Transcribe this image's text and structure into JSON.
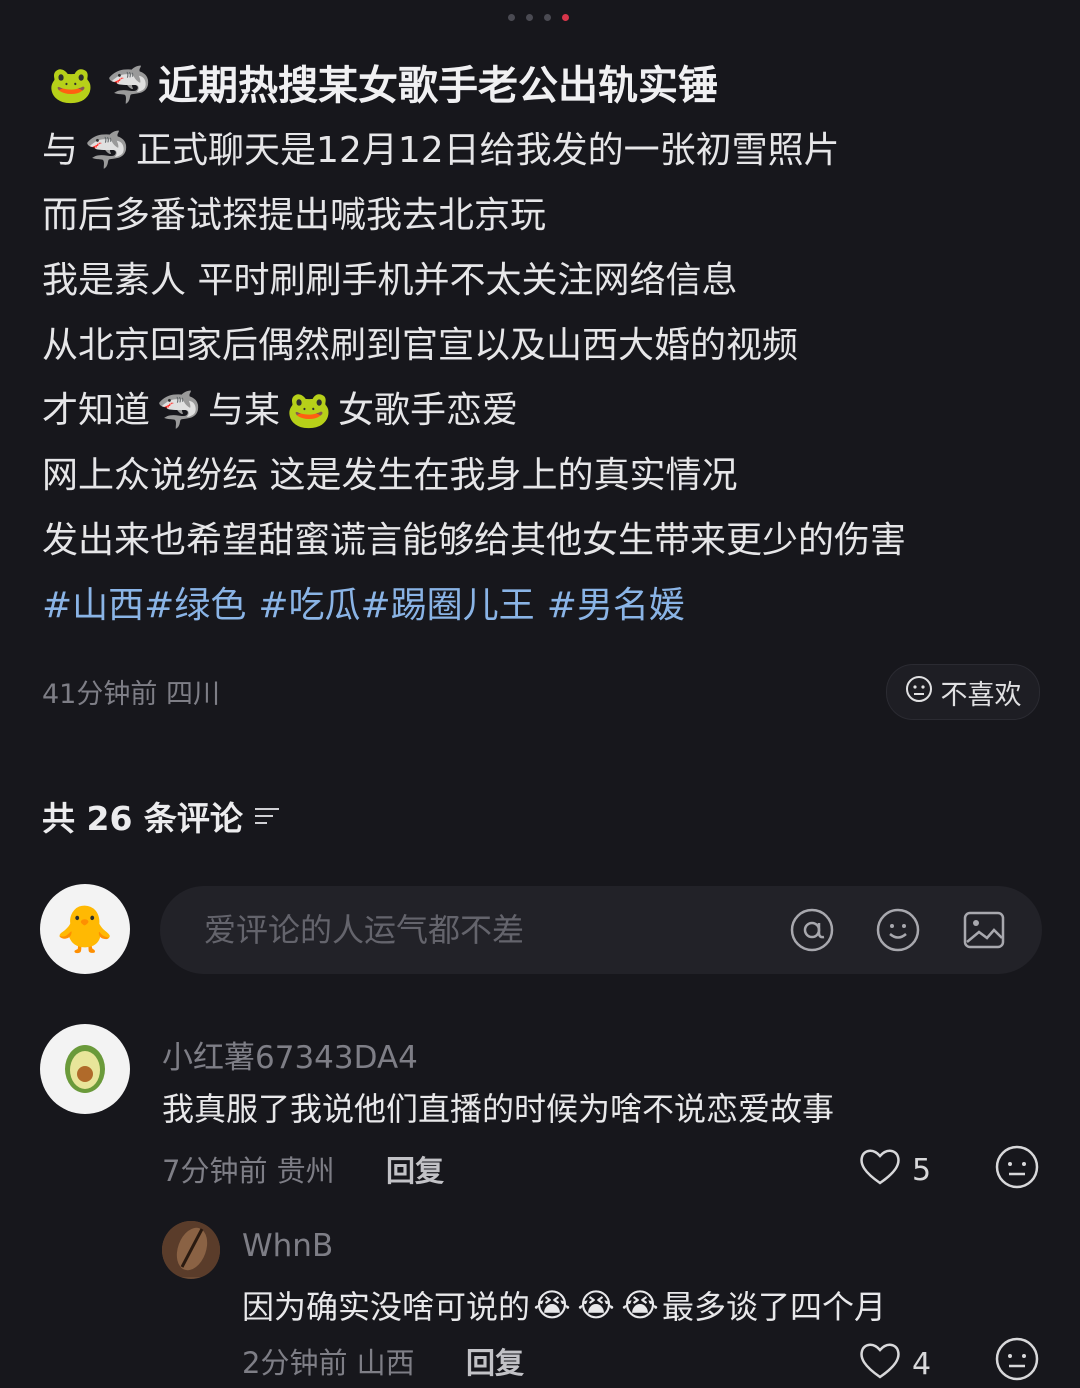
{
  "post": {
    "title_icons": [
      "frog-emoji",
      "shark-emoji"
    ],
    "title": "近期热搜某女歌手老公出轨实锤",
    "line1_a": "与",
    "line1_b": "正式聊天是12月12日给我发的一张初雪照片",
    "line2": "而后多番试探提出喊我去北京玩",
    "line3": "我是素人 平时刷刷手机并不太关注网络信息",
    "line4": "从北京回家后偶然刷到官宣以及山西大婚的视频",
    "line5_a": "才知道",
    "line5_b": "与某",
    "line5_c": "女歌手恋爱",
    "line6": "网上众说纷纭 这是发生在我身上的真实情况",
    "line7": "发出来也希望甜蜜谎言能够给其他女生带来更少的伤害",
    "tags": [
      "#山西",
      "#绿色",
      "#吃瓜",
      "#踢圈儿王",
      "#男名媛"
    ],
    "meta": "41分钟前 四川",
    "dislike_label": "不喜欢"
  },
  "comments_header": "共 26 条评论",
  "input": {
    "placeholder": "爱评论的人运气都不差"
  },
  "comment": {
    "name": "小红薯67343DA4",
    "text": "我真服了我说他们直播的时候为啥不说恋爱故事",
    "time": "7分钟前 贵州",
    "reply_label": "回复",
    "likes": "5"
  },
  "reply": {
    "name": "WhnB",
    "text_a": "因为确实没啥可说的",
    "text_b": "最多谈了四个月",
    "time": "2分钟前 山西",
    "reply_label": "回复",
    "likes": "4"
  },
  "colors": {
    "background": "#17171c",
    "tag": "#8ab4e6",
    "page_indicator_active": "#d8354a"
  }
}
